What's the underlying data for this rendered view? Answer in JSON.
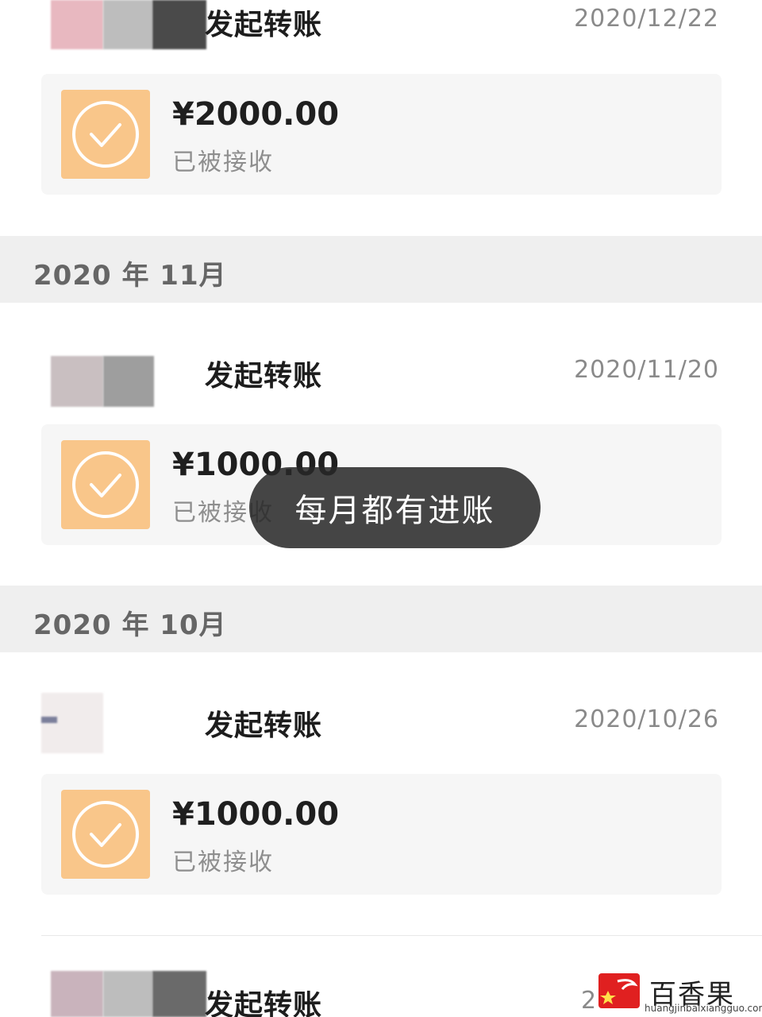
{
  "transfers": [
    {
      "title": "发起转账",
      "date": "2020/12/22",
      "amount": "¥2000.00",
      "status": "已被接收"
    },
    {
      "title": "发起转账",
      "date": "2020/11/20",
      "amount": "¥1000.00",
      "status": "已被接收"
    },
    {
      "title": "发起转账",
      "date": "2020/10/26",
      "amount": "¥1000.00",
      "status": "已被接收"
    },
    {
      "title": "发起转账",
      "date": "2"
    }
  ],
  "months": [
    "2020 年 11月",
    "2020 年 10月"
  ],
  "toast": {
    "text": "每月都有进账"
  },
  "watermark": {
    "title": "百香果号",
    "url": "huangjinbaixiangguo.com"
  },
  "colors": {
    "check_box": "#f9c68a",
    "month_bar": "#efefef",
    "card": "#f6f6f6",
    "toast_bg": "#282828"
  },
  "icons": {
    "check": "check-circle-icon"
  }
}
